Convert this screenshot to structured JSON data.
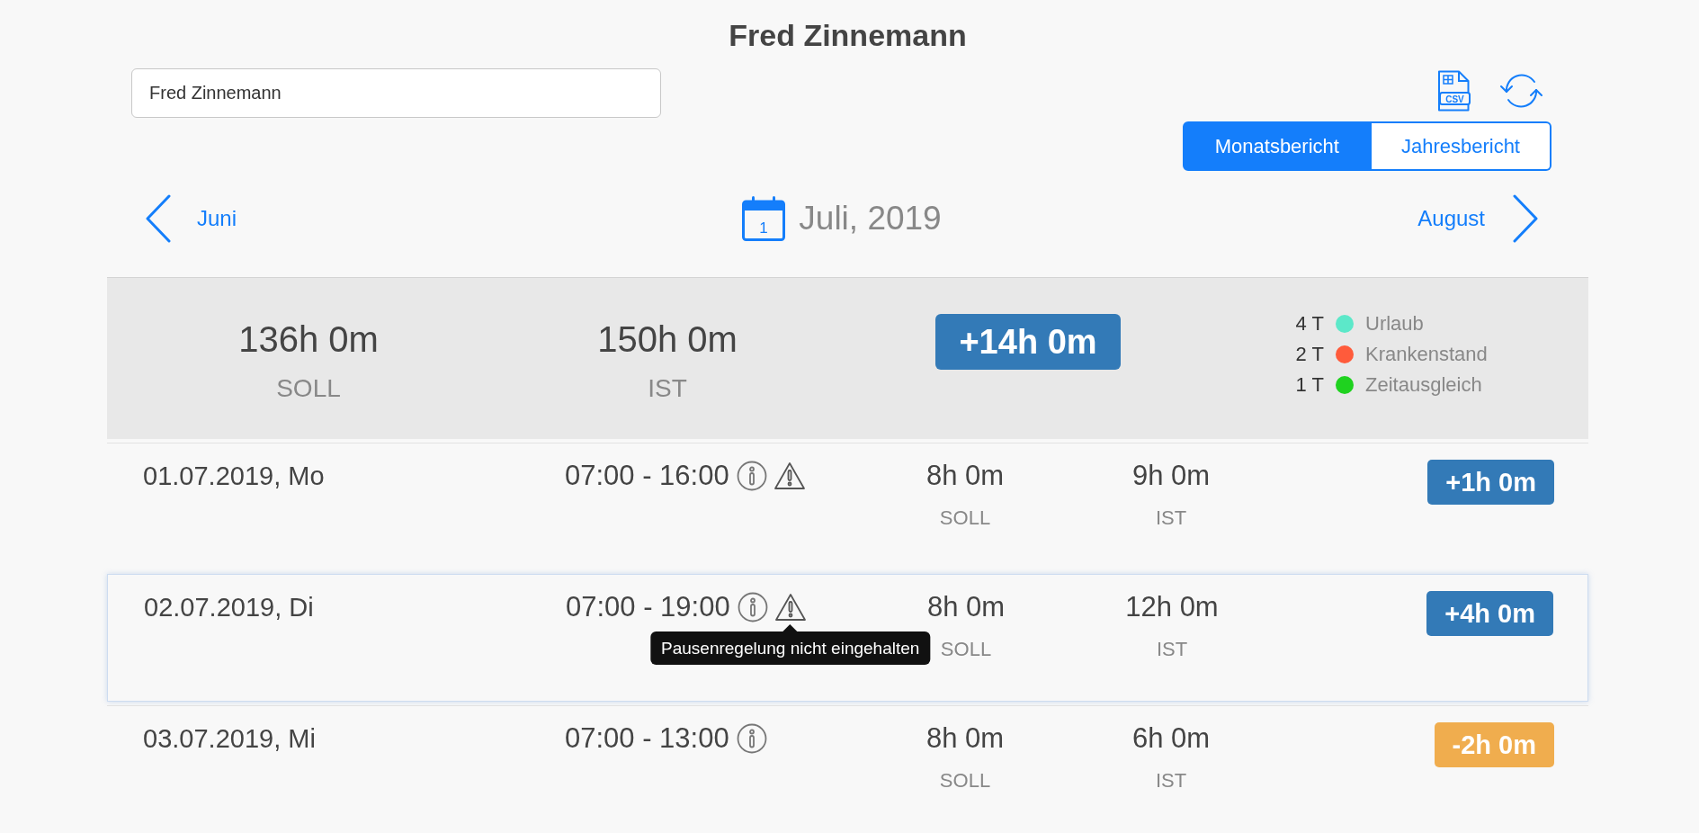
{
  "title": "Fred Zinnemann",
  "search": {
    "value": "Fred Zinnemann"
  },
  "toolbar": {
    "export_icon_text": "CSV"
  },
  "report_tabs": [
    {
      "label": "Monatsbericht",
      "selected": true
    },
    {
      "label": "Jahresbericht",
      "selected": false
    }
  ],
  "month_nav": {
    "previous": "Juni",
    "calendar_day": "1",
    "current": "Juli, 2019",
    "next": "August"
  },
  "summary": {
    "totals": [
      {
        "value": "136h 0m",
        "label": "SOLL"
      },
      {
        "value": "150h 0m",
        "label": "IST"
      }
    ],
    "balance": {
      "text": "+14h 0m",
      "kind": "positive"
    },
    "absences": [
      {
        "count": "4 T",
        "color": "#5ce8c9",
        "label": "Urlaub"
      },
      {
        "count": "2 T",
        "color": "#ff5b3b",
        "label": "Krankenstand"
      },
      {
        "count": "1 T",
        "color": "#1fd21f",
        "label": "Zeitausgleich"
      }
    ]
  },
  "days": [
    {
      "date": "01.07.2019, Mo",
      "time": "07:00 - 16:00",
      "info": true,
      "warning": true,
      "soll": {
        "value": "8h 0m",
        "label": "SOLL"
      },
      "ist": {
        "value": "9h 0m",
        "label": "IST"
      },
      "balance": {
        "text": "+1h 0m",
        "kind": "positive"
      },
      "selected": false
    },
    {
      "date": "02.07.2019, Di",
      "time": "07:00 - 19:00",
      "info": true,
      "warning": true,
      "warning_tooltip": "Pausenregelung nicht eingehalten",
      "soll": {
        "value": "8h 0m",
        "label": "SOLL"
      },
      "ist": {
        "value": "12h 0m",
        "label": "IST"
      },
      "balance": {
        "text": "+4h 0m",
        "kind": "positive"
      },
      "selected": true
    },
    {
      "date": "03.07.2019, Mi",
      "time": "07:00 - 13:00",
      "info": true,
      "warning": false,
      "soll": {
        "value": "8h 0m",
        "label": "SOLL"
      },
      "ist": {
        "value": "6h 0m",
        "label": "IST"
      },
      "balance": {
        "text": "-2h 0m",
        "kind": "negative"
      },
      "selected": false
    }
  ]
}
